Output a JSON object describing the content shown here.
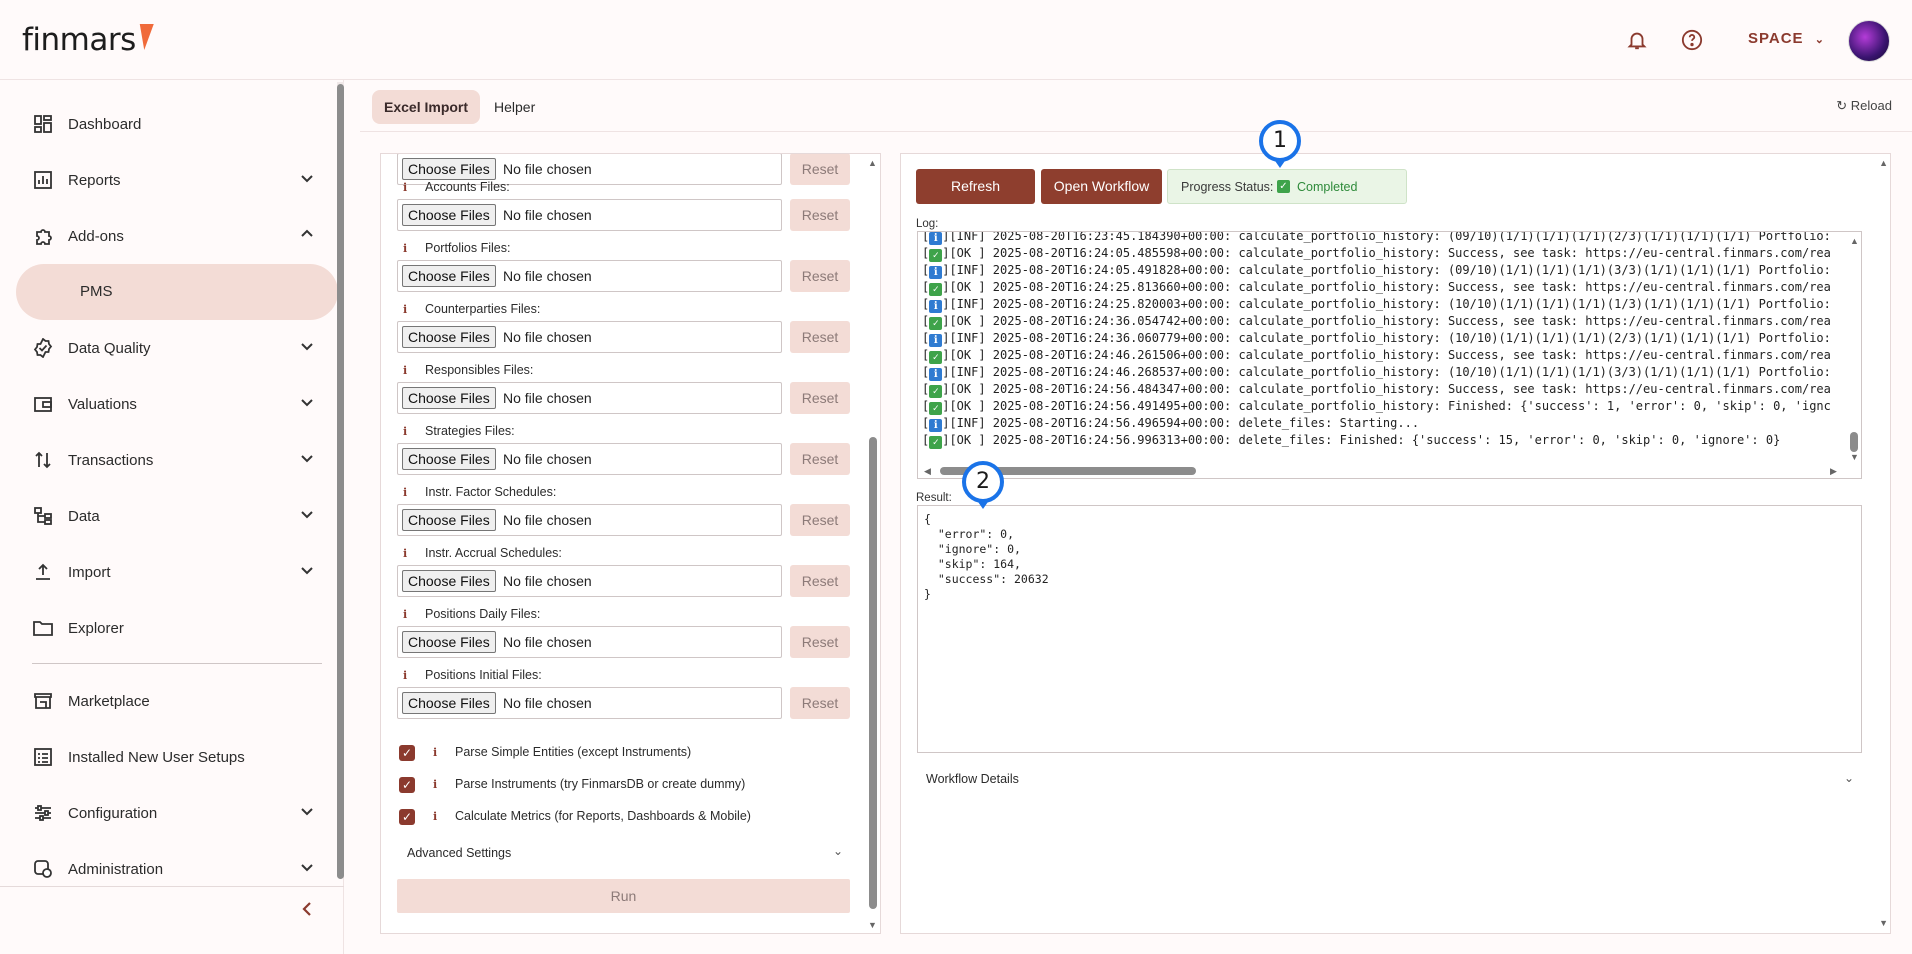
{
  "header": {
    "logo_text": "finmars",
    "space_label": "SPACE",
    "notifications_icon": "bell-icon",
    "help_icon": "question-circle-icon"
  },
  "sidebar": {
    "items": [
      {
        "label": "Dashboard",
        "icon": "dashboard-icon"
      },
      {
        "label": "Reports",
        "icon": "chart-icon"
      },
      {
        "label": "Add-ons",
        "icon": "puzzle-icon"
      },
      {
        "label": "PMS"
      },
      {
        "label": "Data Quality",
        "icon": "badge-check-icon"
      },
      {
        "label": "Valuations",
        "icon": "wallet-icon"
      },
      {
        "label": "Transactions",
        "icon": "arrows-updown-icon"
      },
      {
        "label": "Data",
        "icon": "hierarchy-icon"
      },
      {
        "label": "Import",
        "icon": "upload-icon"
      },
      {
        "label": "Explorer",
        "icon": "folder-icon"
      },
      {
        "label": "Marketplace",
        "icon": "store-icon"
      },
      {
        "label": "Installed New User Setups",
        "icon": "list-card-icon"
      },
      {
        "label": "Configuration",
        "icon": "sliders-icon"
      },
      {
        "label": "Administration",
        "icon": "admin-gear-icon"
      }
    ]
  },
  "tabs": {
    "excel_import": "Excel Import",
    "helper": "Helper",
    "reload": "Reload"
  },
  "import_form": {
    "choose_label": "Choose Files",
    "no_file_label": "No file chosen",
    "reset_label": "Reset",
    "info_glyph": "i",
    "file_fields": [
      "Accounts Files:",
      "Portfolios Files:",
      "Counterparties Files:",
      "Responsibles Files:",
      "Strategies Files:",
      "Instr. Factor Schedules:",
      "Instr. Accrual Schedules:",
      "Positions Daily Files:",
      "Positions Initial Files:"
    ],
    "checkboxes": [
      {
        "label": "Parse Simple Entities (except Instruments)",
        "checked": true
      },
      {
        "label": "Parse Instruments (try FinmarsDB or create dummy)",
        "checked": true
      },
      {
        "label": "Calculate Metrics (for Reports, Dashboards & Mobile)",
        "checked": true
      }
    ],
    "advanced_settings": "Advanced Settings",
    "run_label": "Run"
  },
  "status_panel": {
    "refresh_label": "Refresh",
    "open_workflow_label": "Open Workflow",
    "progress_status_label": "Progress Status:",
    "progress_status_value": "Completed",
    "log_label": "Log:",
    "result_label": "Result:",
    "workflow_details_label": "Workflow Details",
    "colors": {
      "ok": "#3ea34a",
      "inf": "#2f7bd1",
      "accent": "#8e3e2e"
    }
  },
  "log_lines": [
    {
      "level": "inf",
      "text": "][INF] 2025-08-20T16:23:45.184390+00:00: calculate_portfolio_history: (09/10)(1/1)(1/1)(1/1)(2/3)(1/1)(1/1)(1/1) Portfolio:"
    },
    {
      "level": "ok",
      "text": "][OK ] 2025-08-20T16:24:05.485598+00:00: calculate_portfolio_history: Success, see task: https://eu-central.finmars.com/rea"
    },
    {
      "level": "inf",
      "text": "][INF] 2025-08-20T16:24:05.491828+00:00: calculate_portfolio_history: (09/10)(1/1)(1/1)(1/1)(3/3)(1/1)(1/1)(1/1) Portfolio:"
    },
    {
      "level": "ok",
      "text": "][OK ] 2025-08-20T16:24:25.813660+00:00: calculate_portfolio_history: Success, see task: https://eu-central.finmars.com/rea"
    },
    {
      "level": "inf",
      "text": "][INF] 2025-08-20T16:24:25.820003+00:00: calculate_portfolio_history: (10/10)(1/1)(1/1)(1/1)(1/3)(1/1)(1/1)(1/1) Portfolio:"
    },
    {
      "level": "ok",
      "text": "][OK ] 2025-08-20T16:24:36.054742+00:00: calculate_portfolio_history: Success, see task: https://eu-central.finmars.com/rea"
    },
    {
      "level": "inf",
      "text": "][INF] 2025-08-20T16:24:36.060779+00:00: calculate_portfolio_history: (10/10)(1/1)(1/1)(1/1)(2/3)(1/1)(1/1)(1/1) Portfolio:"
    },
    {
      "level": "ok",
      "text": "][OK ] 2025-08-20T16:24:46.261506+00:00: calculate_portfolio_history: Success, see task: https://eu-central.finmars.com/rea"
    },
    {
      "level": "inf",
      "text": "][INF] 2025-08-20T16:24:46.268537+00:00: calculate_portfolio_history: (10/10)(1/1)(1/1)(1/1)(3/3)(1/1)(1/1)(1/1) Portfolio:"
    },
    {
      "level": "ok",
      "text": "][OK ] 2025-08-20T16:24:56.484347+00:00: calculate_portfolio_history: Success, see task: https://eu-central.finmars.com/rea"
    },
    {
      "level": "ok",
      "text": "][OK ] 2025-08-20T16:24:56.491495+00:00: calculate_portfolio_history: Finished: {'success': 1, 'error': 0, 'skip': 0, 'ignc"
    },
    {
      "level": "inf",
      "text": "][INF] 2025-08-20T16:24:56.496594+00:00: delete_files: Starting..."
    },
    {
      "level": "ok",
      "text": "][OK ] 2025-08-20T16:24:56.996313+00:00: delete_files: Finished: {'success': 15, 'error': 0, 'skip': 0, 'ignore': 0}"
    }
  ],
  "result": {
    "json_text": "{\n  \"error\": 0,\n  \"ignore\": 0,\n  \"skip\": 164,\n  \"success\": 20632\n}"
  },
  "markers": [
    "1",
    "2"
  ]
}
